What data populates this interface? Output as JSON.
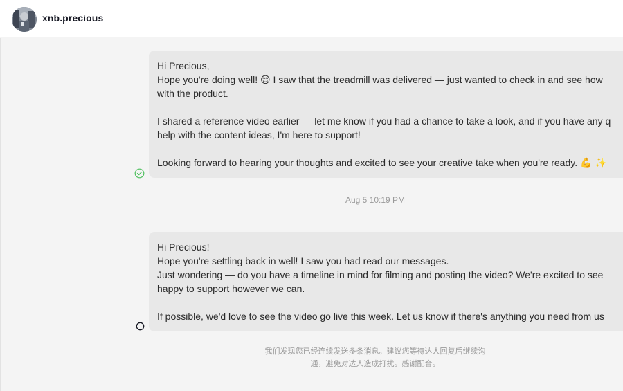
{
  "header": {
    "username": "xnb.precious",
    "avatar_icon": "user-avatar-photo"
  },
  "messages": [
    {
      "lines": [
        "Hi Precious,",
        "Hope you're doing well! 😊 I saw that the treadmill was delivered — just wanted to check in and see how",
        "with the product.",
        "",
        "I shared a reference video earlier — let me know if you had a chance to take a look, and if you have any q",
        "help with the content ideas, I'm here to support!",
        "",
        "Looking forward to hearing your thoughts and excited to see your creative take when you're ready. 💪 ✨"
      ],
      "status": "read",
      "status_icon": "check-circle-icon"
    },
    {
      "lines": [
        "Hi Precious!",
        "Hope you're settling back in well! I saw you had read our messages.",
        "Just wondering — do you have a timeline in mind for filming and posting the video? We're excited to see",
        "happy to support however we can.",
        "",
        "If possible, we'd love to see the video go live this week. Let us know if there's anything you need from us"
      ],
      "status": "sent",
      "status_icon": "circle-icon"
    }
  ],
  "timestamp": "Aug 5 10:19 PM",
  "notice": {
    "line1": "我们发现您已经连续发送多条消息。建议您等待达人回复后继续沟",
    "line2": "通，避免对达人造成打扰。感谢配合。"
  },
  "colors": {
    "bubble_bg": "#e8e8e8",
    "read_status": "#4cbf5c",
    "muted_text": "#9a9a9a"
  }
}
